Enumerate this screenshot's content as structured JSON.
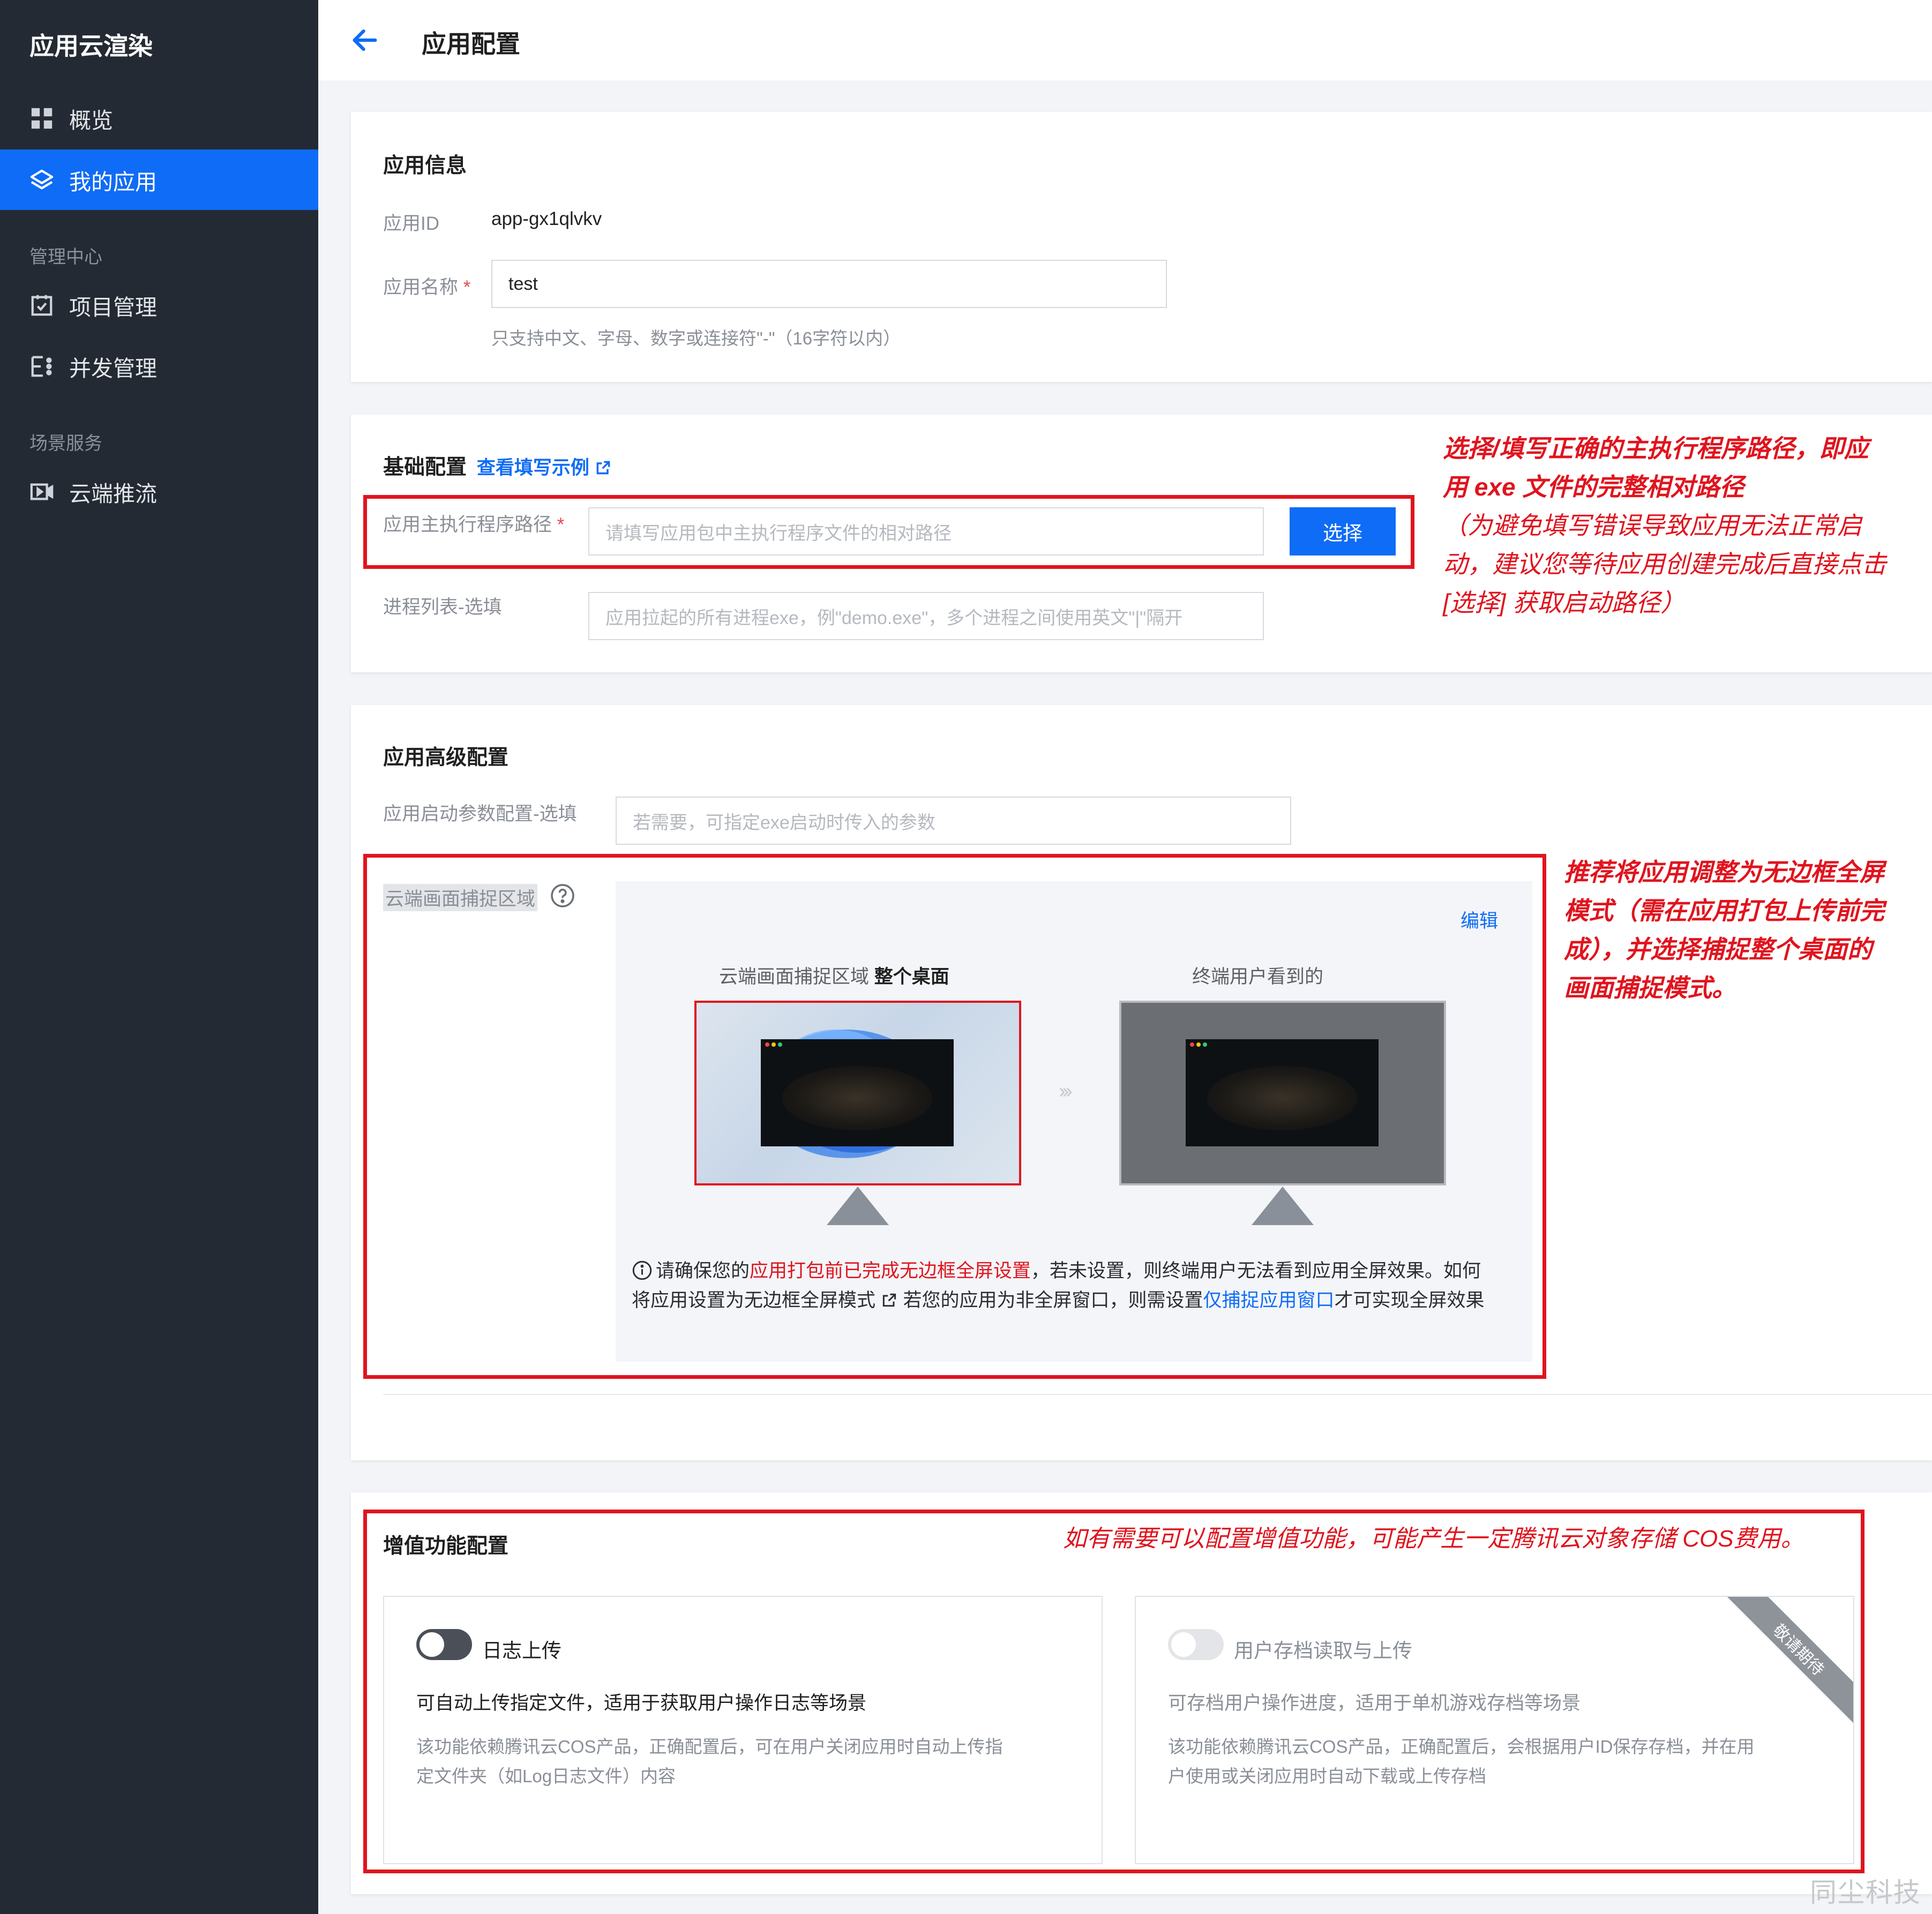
{
  "sidebar": {
    "brand": "应用云渲染",
    "items": [
      {
        "label": "概览",
        "icon": "grid-icon"
      },
      {
        "label": "我的应用",
        "icon": "layers-icon",
        "active": true
      }
    ],
    "group_manage": "管理中心",
    "manage_items": [
      {
        "label": "项目管理",
        "icon": "project-icon"
      },
      {
        "label": "并发管理",
        "icon": "concurrency-icon"
      }
    ],
    "group_scene": "场景服务",
    "scene_items": [
      {
        "label": "云端推流",
        "icon": "stream-icon"
      }
    ]
  },
  "header": {
    "title": "应用配置"
  },
  "app_info": {
    "title": "应用信息",
    "id_label": "应用ID",
    "id_value": "app-gx1qlvkv",
    "name_label": "应用名称",
    "required_mark": "*",
    "name_value": "test",
    "name_hint": "只支持中文、字母、数字或连接符\"-\"（16字符以内）"
  },
  "basic_config": {
    "title": "基础配置",
    "example_link": "查看填写示例",
    "exe_path_label": "应用主执行程序路径",
    "exe_path_placeholder": "请填写应用包中主执行程序文件的相对路径",
    "select_button": "选择",
    "process_label": "进程列表-选填",
    "process_placeholder": "应用拉起的所有进程exe，例\"demo.exe\"，多个进程之间使用英文\"|\"隔开"
  },
  "annotation_1": {
    "line1": "选择/填写正确的主执行程序路径，即应",
    "line2": "用 exe 文件的完整相对路径",
    "line3": "（为避免填写错误导致应用无法正常启",
    "line4": "动，建议您等待应用创建完成后直接点击",
    "line5": "[选择] 获取启动路径）"
  },
  "advanced_config": {
    "title": "应用高级配置",
    "param_label": "应用启动参数配置-选填",
    "param_placeholder": "若需要，可指定exe启动时传入的参数",
    "capture_label": "云端画面捕捉区域",
    "edit_link": "编辑",
    "cloud_caption": "云端画面捕捉区域",
    "cloud_caption_bold": "整个桌面",
    "user_caption": "终端用户看到的",
    "notice_part1": "请确保您的",
    "notice_red": "应用打包前已完成无边框全屏设置",
    "notice_part2": "，若未设置，则终端用户无法看到应用全屏效果。如何",
    "notice_part3": "将应用设置为无边框全屏模式",
    "notice_part4": "若您的应用为非全屏窗口，则需设置",
    "notice_link": "仅捕捉应用窗口",
    "notice_part5": "才可实现全屏效果"
  },
  "annotation_2": {
    "line1": "推荐将应用调整为无边框全屏",
    "line2": "模式（需在应用打包上传前完",
    "line3": "成），并选择捕捉整个桌面的",
    "line4": "画面捕捉模式。"
  },
  "value_added": {
    "title": "增值功能配置",
    "annotation": "如有需要可以配置增值功能，可能产生一定腾讯云对象存储 COS费用。",
    "log_upload": {
      "label": "日志上传",
      "desc": "可自动上传指定文件，适用于获取用户操作日志等场景",
      "note_line1": "该功能依赖腾讯云COS产品，正确配置后，可在用户关闭应用时自动上传指",
      "note_line2": "定文件夹（如Log日志文件）内容"
    },
    "save_upload": {
      "label": "用户存档读取与上传",
      "badge": "敬请期待",
      "desc": "可存档用户操作进度，适用于单机游戏存档等场景",
      "note_line1": "该功能依赖腾讯云COS产品，正确配置后，会根据用户ID保存存档，并在用",
      "note_line2": "户使用或关闭应用时自动下载或上传存档"
    }
  },
  "watermark": "同尘科技",
  "colors": {
    "accent": "#0f6cf6",
    "sidebar": "#242a33",
    "annotation": "#e0141e"
  }
}
